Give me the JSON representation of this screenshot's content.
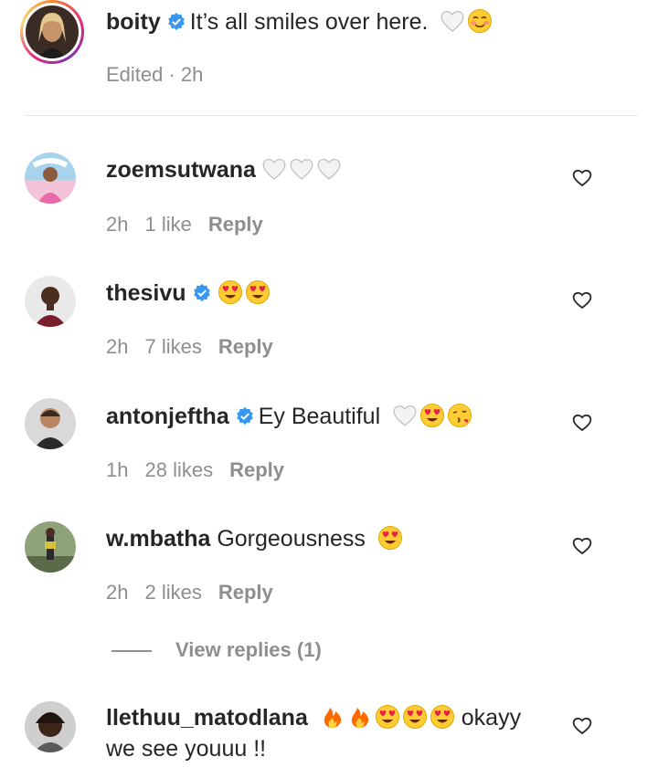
{
  "caption": {
    "username": "boity",
    "text": "It’s all smiles over here.",
    "emojis": [
      "white-heart",
      "smiling-face-blushing"
    ],
    "meta": "Edited · 2h"
  },
  "comments": [
    {
      "username": "zoemsutwana",
      "verified": false,
      "text": "",
      "emojis": [
        "white-heart",
        "white-heart",
        "white-heart"
      ],
      "time": "2h",
      "likes": "1 like",
      "reply": "Reply"
    },
    {
      "username": "thesivu",
      "verified": true,
      "text": "",
      "emojis": [
        "heart-eyes",
        "heart-eyes"
      ],
      "time": "2h",
      "likes": "7 likes",
      "reply": "Reply"
    },
    {
      "username": "antonjeftha",
      "verified": true,
      "text": "Ey Beautiful",
      "emojis": [
        "white-heart",
        "heart-eyes",
        "kiss-face"
      ],
      "time": "1h",
      "likes": "28 likes",
      "reply": "Reply"
    },
    {
      "username": "w.mbatha",
      "verified": false,
      "text": "Gorgeousness",
      "emojis": [
        "heart-eyes"
      ],
      "time": "2h",
      "likes": "2 likes",
      "reply": "Reply"
    },
    {
      "username": "llethuu_matodlana",
      "verified": false,
      "emojis": [
        "fire",
        "fire",
        "heart-eyes",
        "heart-eyes",
        "heart-eyes"
      ],
      "text_after": "okayy",
      "text_line2": "we see youuu !!"
    }
  ],
  "view_replies": "View replies (1)",
  "colors": {
    "text": "#262626",
    "secondary": "#8e8e8e",
    "verified": "#3897f0"
  }
}
